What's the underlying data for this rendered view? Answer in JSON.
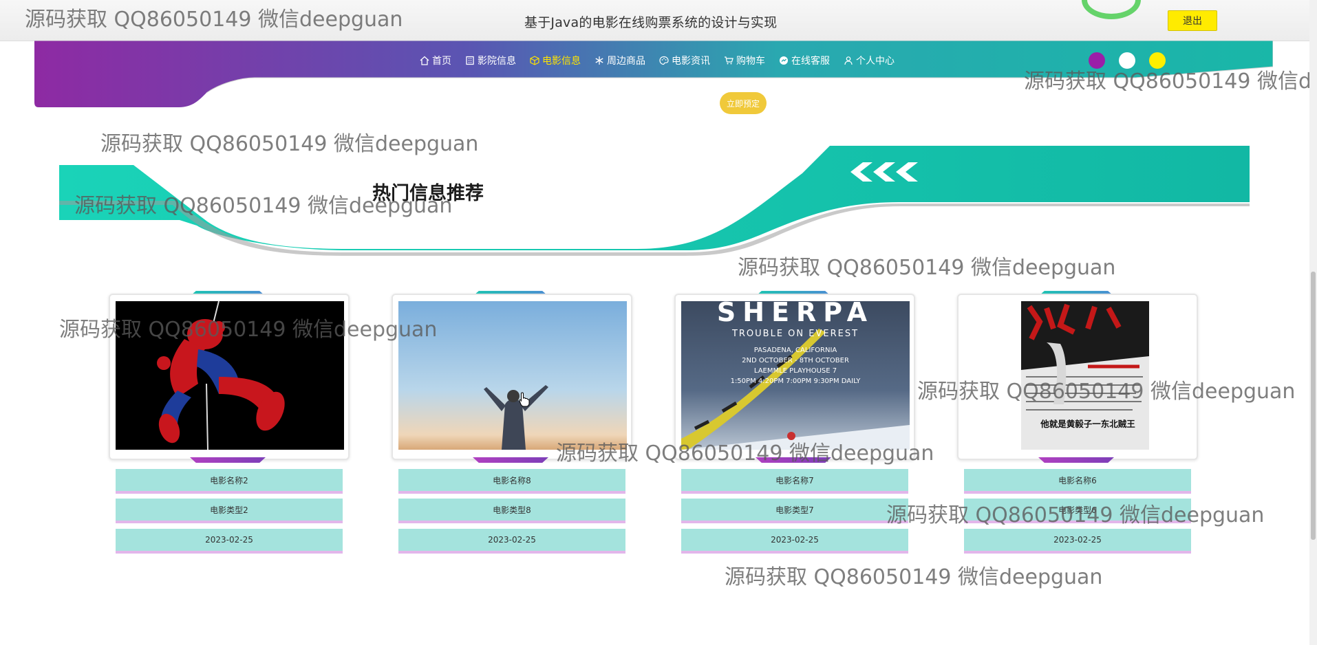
{
  "header": {
    "title": "基于Java的电影在线购票系统的设计与实现",
    "logout_label": "退出"
  },
  "nav": {
    "items": [
      {
        "label": "首页",
        "icon": "home-icon"
      },
      {
        "label": "影院信息",
        "icon": "building-icon"
      },
      {
        "label": "电影信息",
        "icon": "cube-icon",
        "active": true
      },
      {
        "label": "周边商品",
        "icon": "snowflake-icon"
      },
      {
        "label": "电影资讯",
        "icon": "palette-icon"
      },
      {
        "label": "购物车",
        "icon": "cart-icon"
      },
      {
        "label": "在线客服",
        "icon": "support-icon"
      },
      {
        "label": "个人中心",
        "icon": "user-icon"
      }
    ],
    "theme_dots": [
      "#9b1fa8",
      "#ffffff",
      "#ffee00"
    ]
  },
  "hero": {
    "book_now_label": "立即预定"
  },
  "section": {
    "title": "热门信息推荐"
  },
  "cards": [
    {
      "name": "电影名称2",
      "type": "电影类型2",
      "date": "2023-02-25",
      "poster": "spider-man"
    },
    {
      "name": "电影名称8",
      "type": "电影类型8",
      "date": "2023-02-25",
      "poster": "sky-person"
    },
    {
      "name": "电影名称7",
      "type": "电影类型7",
      "date": "2023-02-25",
      "poster": "sherpa",
      "poster_lines": [
        "SHERPA",
        "TROUBLE ON EVEREST",
        "PASADENA, CALIFORNIA",
        "2ND OCTOBER - 8TH OCTOBER",
        "LAEMMLE PLAYHOUSE 7",
        "1:50PM 4:20PM 7:00PM 9:30PM DAILY"
      ]
    },
    {
      "name": "电影名称6",
      "type": "电影类型6",
      "date": "2023-02-25",
      "poster": "book-cover",
      "poster_lines": [
        "他就是黄毅子一东北贼王"
      ]
    }
  ],
  "watermark": "源码获取 QQ86050149 微信deepguan"
}
